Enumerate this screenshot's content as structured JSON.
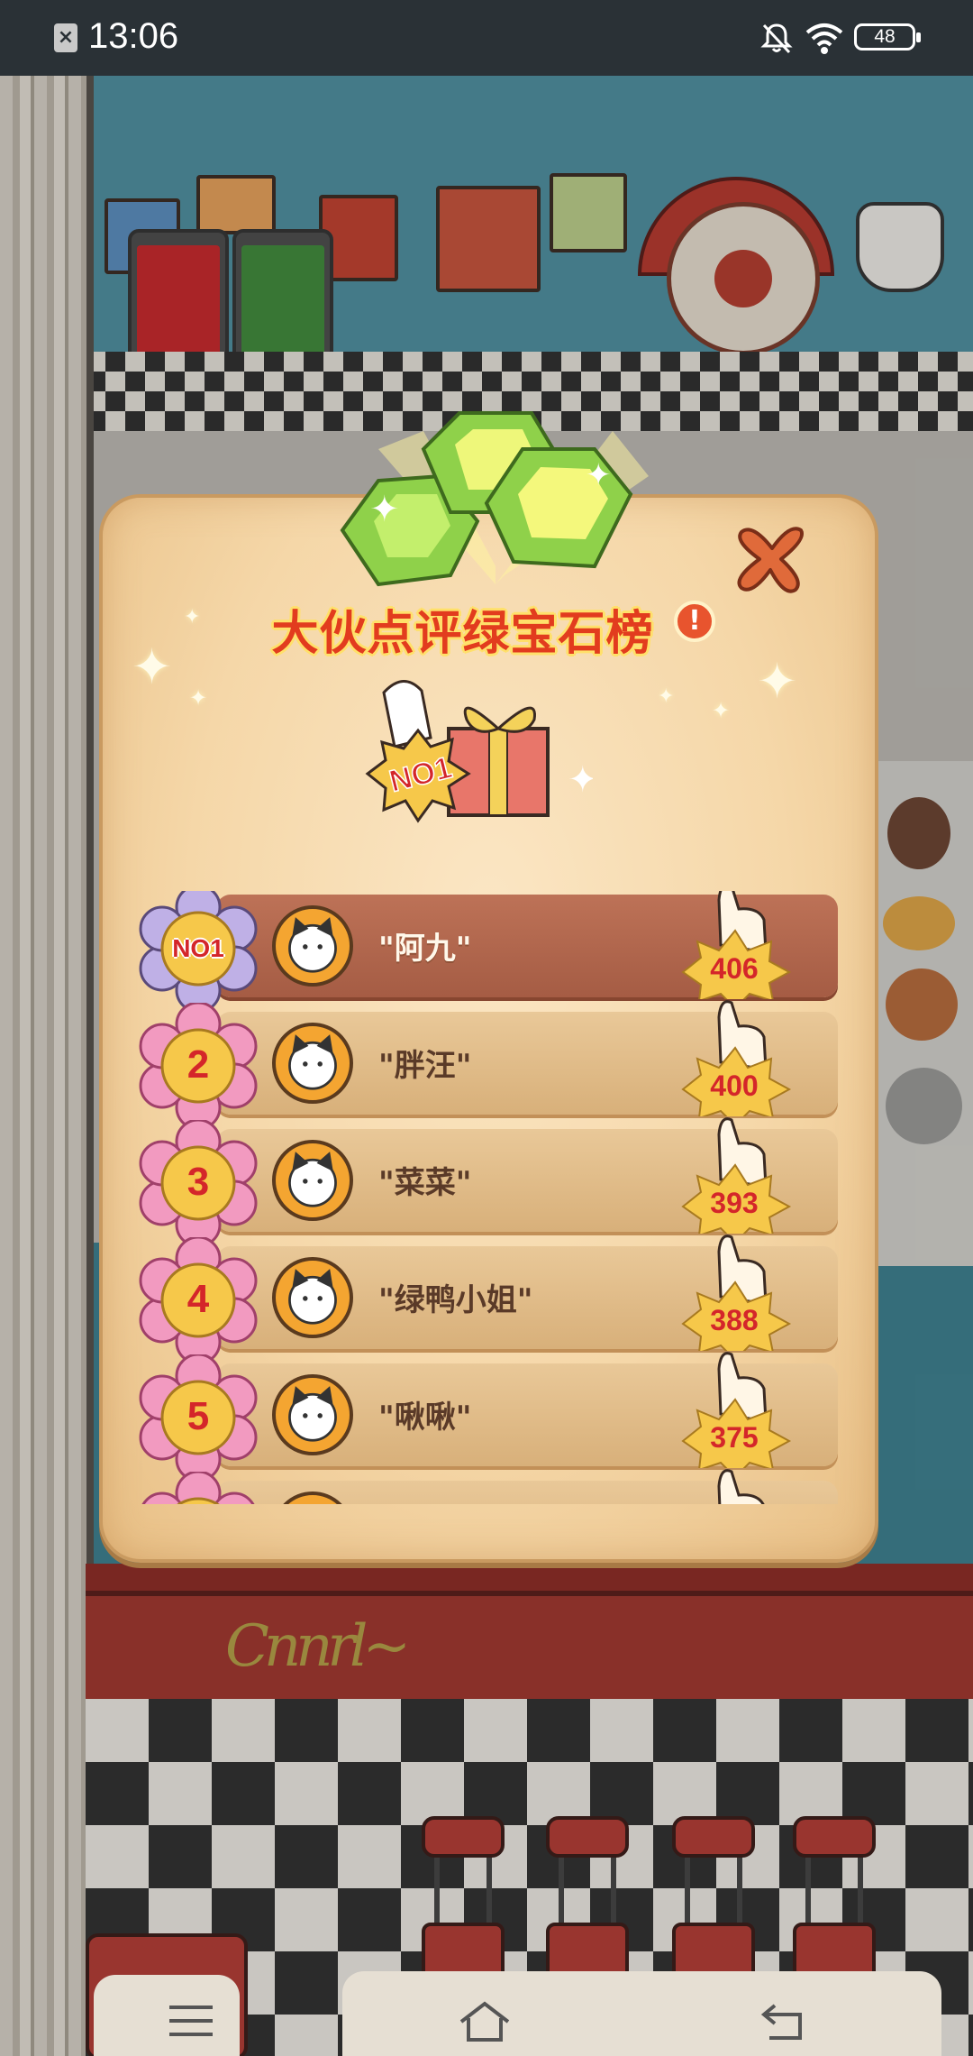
{
  "status_bar": {
    "time": "13:06",
    "battery": "48",
    "icons": [
      "close-notification-icon",
      "bell-muted-icon",
      "wifi-icon",
      "battery-icon"
    ]
  },
  "dialog": {
    "title": "大伙点评绿宝石榜",
    "info_button": "!",
    "gift_badge": "NO1",
    "icons": [
      "green-gems-icon",
      "close-icon",
      "gift-box-icon",
      "thumbs-up-icon"
    ],
    "ranking": [
      {
        "rank": "NO1",
        "name": "\"阿九\"",
        "likes": "406"
      },
      {
        "rank": "2",
        "name": "\"胖汪\"",
        "likes": "400"
      },
      {
        "rank": "3",
        "name": "\"菜菜\"",
        "likes": "393"
      },
      {
        "rank": "4",
        "name": "\"绿鸭小姐\"",
        "likes": "388"
      },
      {
        "rank": "5",
        "name": "\"啾啾\"",
        "likes": "375"
      }
    ]
  },
  "colors": {
    "title_red": "#e23c1e",
    "title_outline": "#ffe06a",
    "first_row": "#b06548",
    "other_rows": "#deba86",
    "score_red": "#d4262a"
  },
  "nav_bar": {
    "icons": [
      "menu-icon",
      "home-icon",
      "back-icon"
    ]
  }
}
